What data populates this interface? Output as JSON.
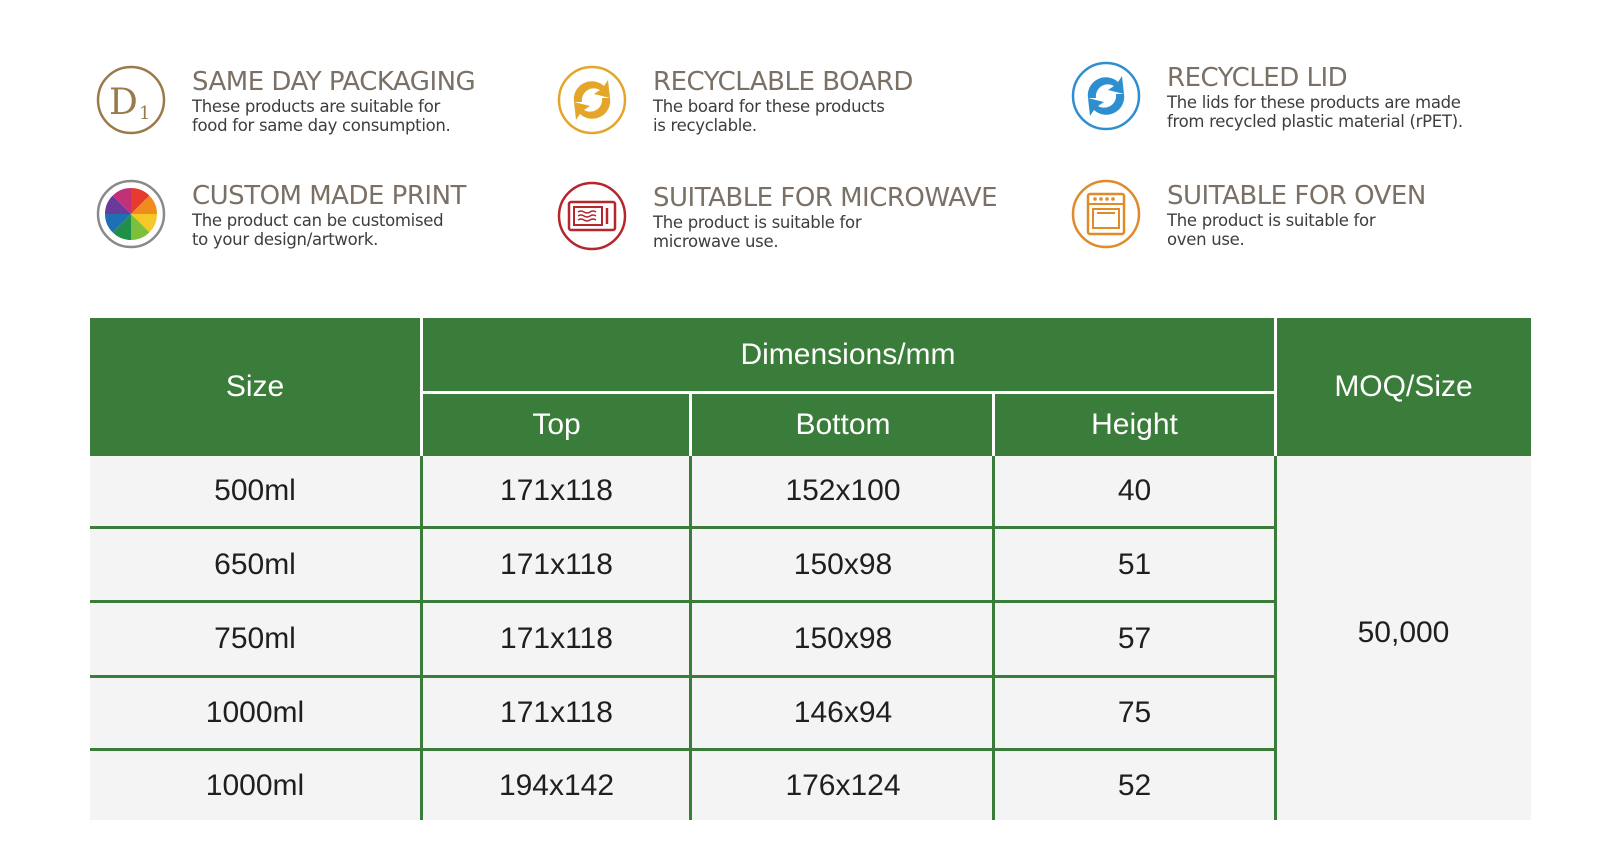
{
  "features": [
    {
      "title": "SAME DAY PACKAGING",
      "desc": "These products are suitable for\nfood for same day consumption.",
      "icon": "same-day-d1-icon",
      "color": "#9b7a4a"
    },
    {
      "title": "RECYCLABLE BOARD",
      "desc": "The board for these products\nis recyclable.",
      "icon": "recycle-arrows-icon",
      "color": "#e3a62a"
    },
    {
      "title": "RECYCLED LID",
      "desc": "The lids for these products are made\nfrom recycled plastic material (rPET).",
      "icon": "recycle-arrows-icon",
      "color": "#2e8fd0"
    },
    {
      "title": "CUSTOM MADE PRINT",
      "desc": "The product can be customised\nto your design/artwork.",
      "icon": "color-wheel-icon",
      "color": "#8a8a8a"
    },
    {
      "title": "SUITABLE FOR MICROWAVE",
      "desc": "The product is suitable for\nmicrowave use.",
      "icon": "microwave-icon",
      "color": "#b5272d"
    },
    {
      "title": "SUITABLE FOR OVEN",
      "desc": "The product is suitable for\noven use.",
      "icon": "oven-icon",
      "color": "#e08a2a"
    }
  ],
  "table": {
    "size_header": "Size",
    "dimensions_header": "Dimensions/mm",
    "top_header": "Top",
    "bottom_header": "Bottom",
    "height_header": "Height",
    "moq_header": "MOQ/Size",
    "moq_value": "50,000",
    "rows": [
      {
        "size": "500ml",
        "top": "171x118",
        "bottom": "152x100",
        "height": "40"
      },
      {
        "size": "650ml",
        "top": "171x118",
        "bottom": "150x98",
        "height": "51"
      },
      {
        "size": "750ml",
        "top": "171x118",
        "bottom": "150x98",
        "height": "57"
      },
      {
        "size": "1000ml",
        "top": "171x118",
        "bottom": "146x94",
        "height": "75"
      },
      {
        "size": "1000ml",
        "top": "194x142",
        "bottom": "176x124",
        "height": "52"
      }
    ]
  },
  "colors": {
    "table_green": "#3a7c39",
    "cell_bg": "#f4f4f4"
  }
}
